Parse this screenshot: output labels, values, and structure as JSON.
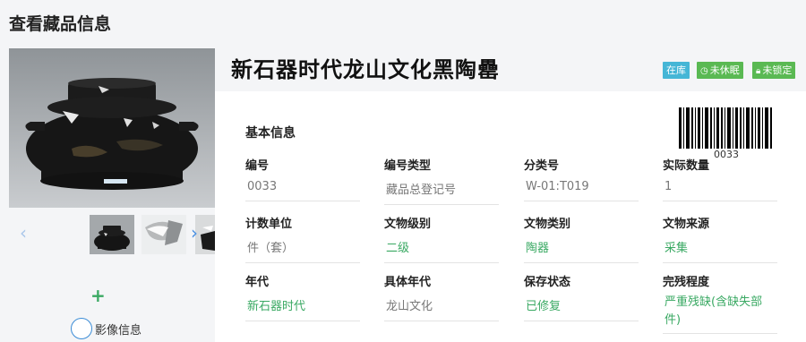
{
  "page_title": "查看藏品信息",
  "item_title": "新石器时代龙山文化黑陶罍",
  "badges": {
    "in_stock": "在库",
    "not_dormant": "未休眠",
    "not_locked": "未锁定"
  },
  "section_title": "基本信息",
  "barcode_number": "0033",
  "media": {
    "label": "影像信息",
    "add_symbol": "+"
  },
  "nav": {
    "prev": "‹",
    "next": "›"
  },
  "fields": [
    {
      "label": "编号",
      "value": "0033"
    },
    {
      "label": "编号类型",
      "value": "藏品总登记号"
    },
    {
      "label": "分类号",
      "value": "W-01:T019"
    },
    {
      "label": "实际数量",
      "value": "1"
    },
    {
      "label": "计数单位",
      "value": "件（套）"
    },
    {
      "label": "文物级别",
      "value": "二级"
    },
    {
      "label": "文物类别",
      "value": "陶器"
    },
    {
      "label": "文物来源",
      "value": "采集"
    },
    {
      "label": "年代",
      "value": "新石器时代"
    },
    {
      "label": "具体年代",
      "value": "龙山文化"
    },
    {
      "label": "保存状态",
      "value": "已修复"
    },
    {
      "label": "完残程度",
      "value": "严重残缺(含缺失部件)"
    }
  ],
  "colors": {
    "accent_green": "#3aa963",
    "badge_blue": "#45b6d6",
    "badge_green": "#5ab953",
    "link_blue": "#4a90e2"
  }
}
